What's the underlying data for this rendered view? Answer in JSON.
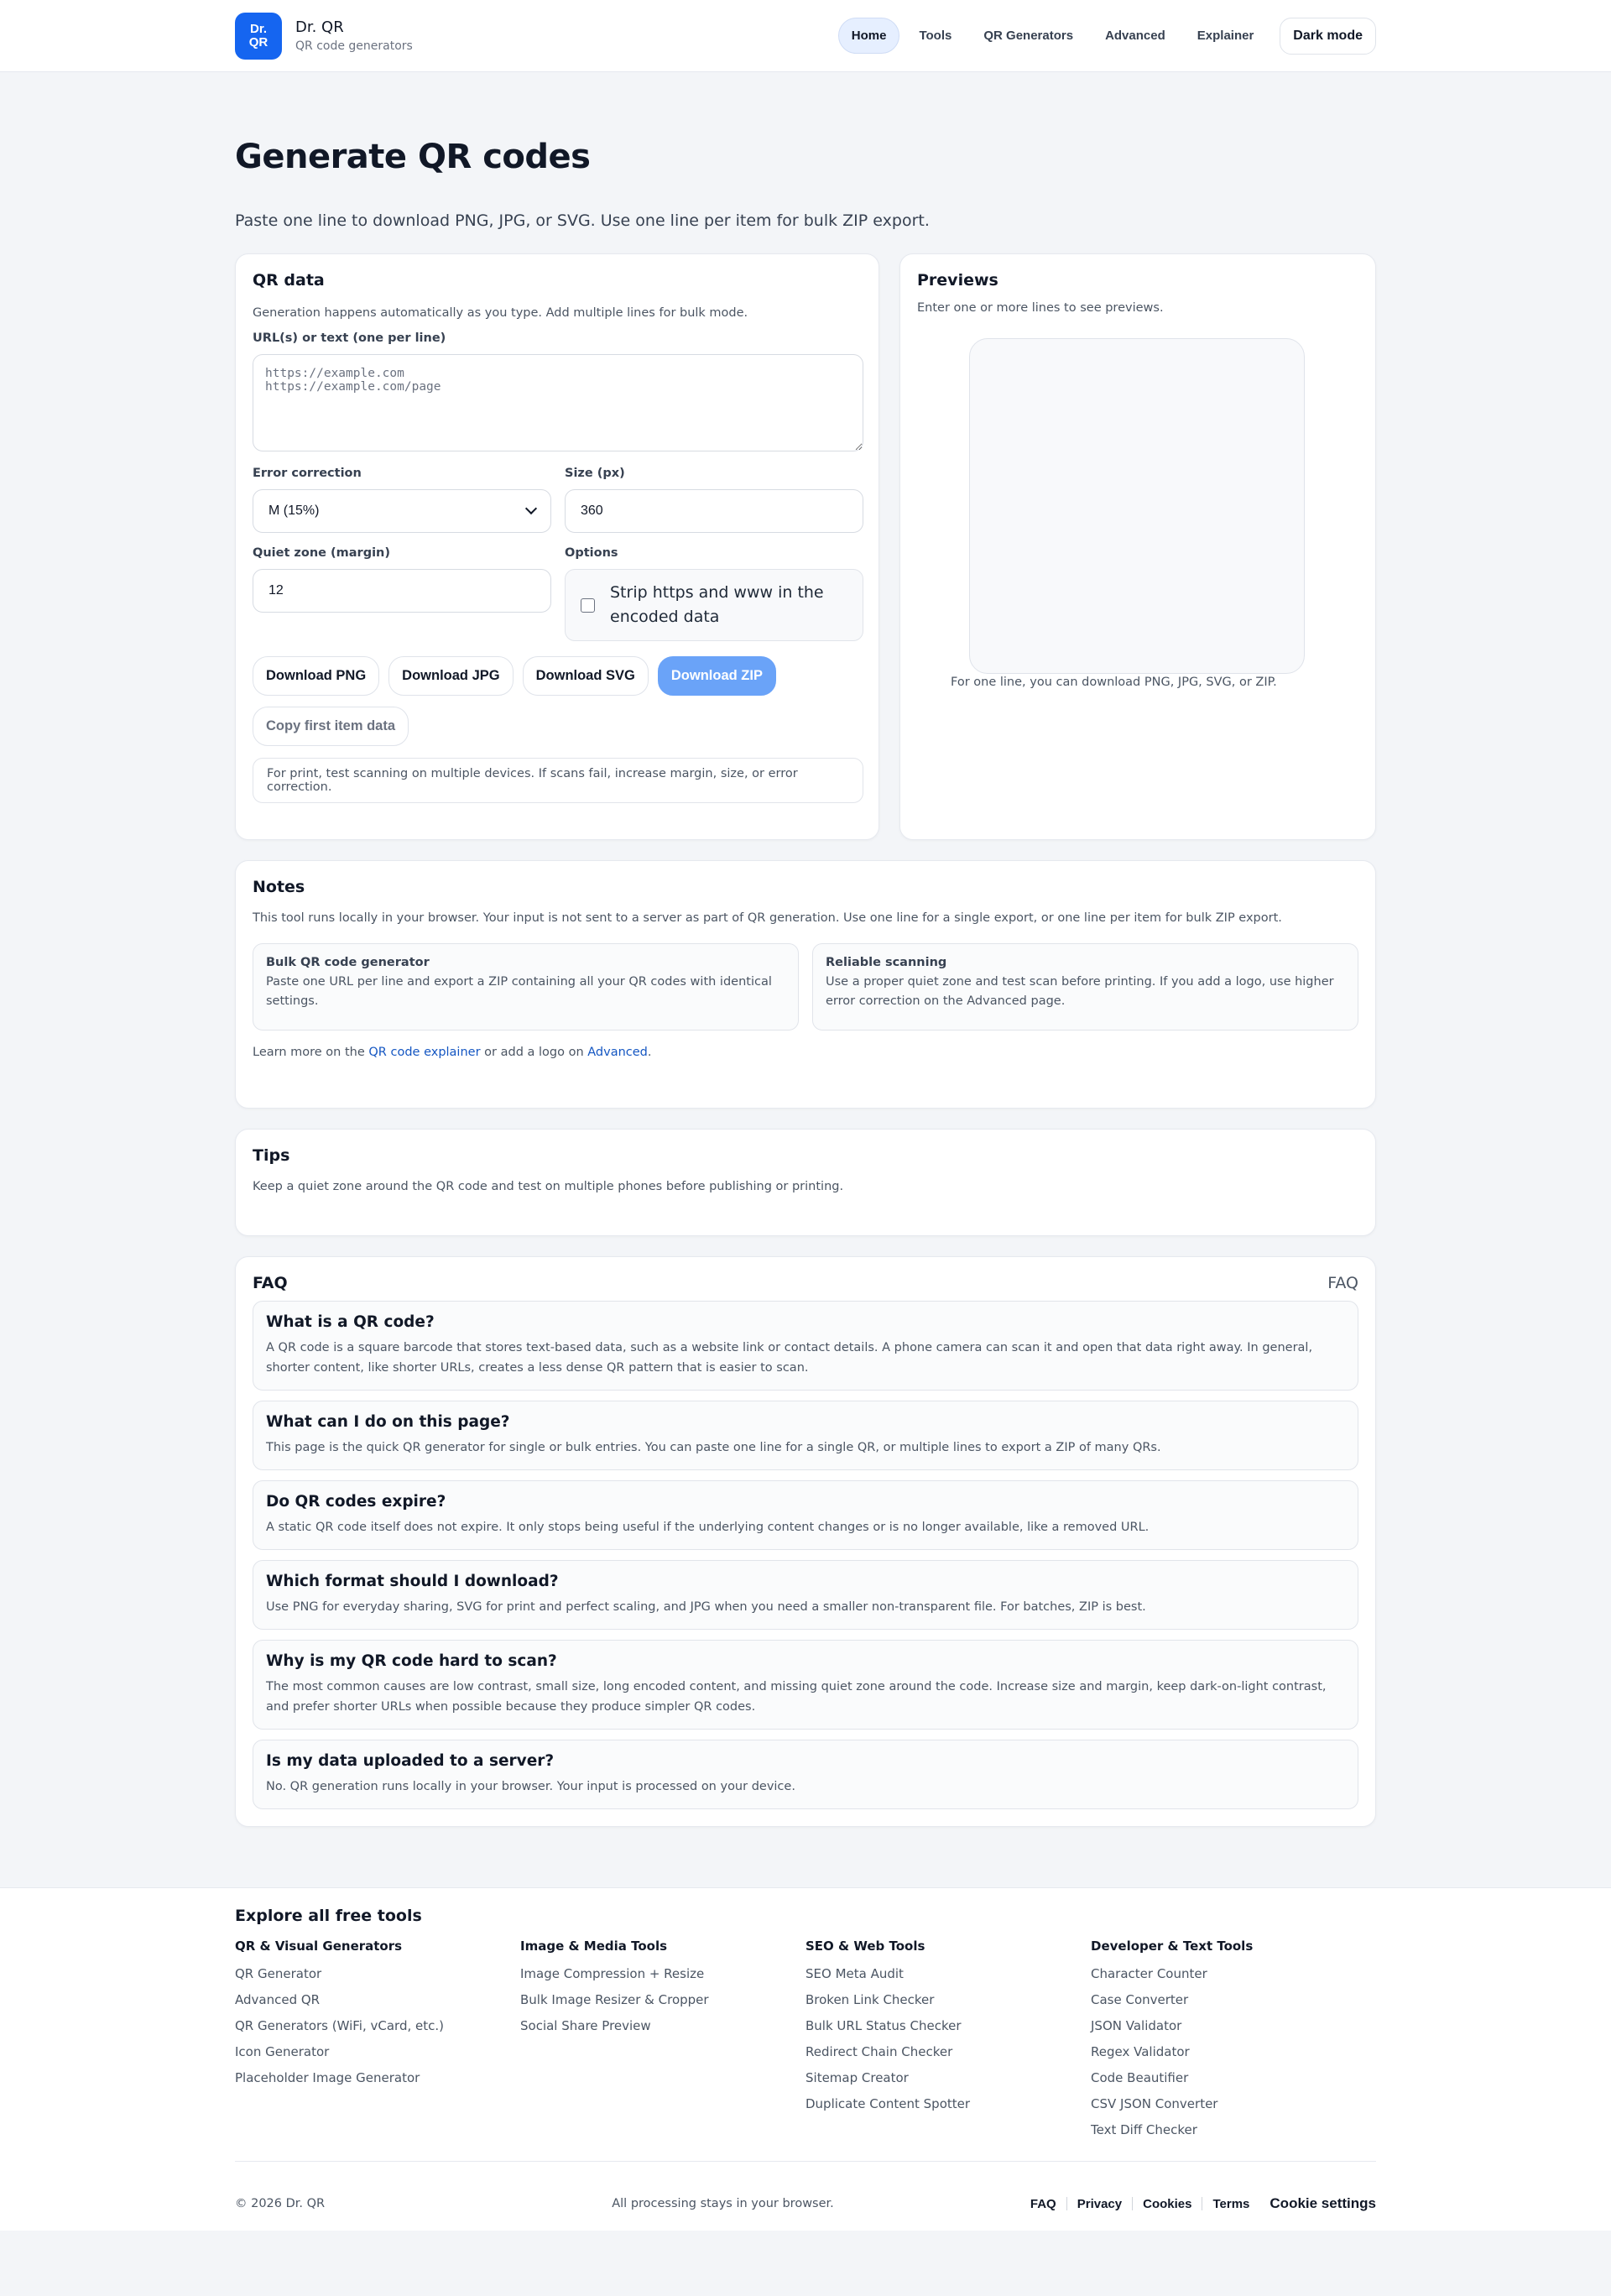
{
  "brand": {
    "logo_line1": "Dr.",
    "logo_line2": "QR",
    "name": "Dr. QR",
    "subtitle": "QR code generators"
  },
  "nav": {
    "items": [
      "Home",
      "Tools",
      "QR Generators",
      "Advanced",
      "Explainer"
    ],
    "active": "Home",
    "dark_mode": "Dark mode"
  },
  "hero": {
    "title": "Generate QR codes",
    "lead": "Paste one line to download PNG, JPG, or SVG. Use one line per item for bulk ZIP export."
  },
  "qr_data": {
    "title": "QR data",
    "desc": "Generation happens automatically as you type. Add multiple lines for bulk mode.",
    "input_label": "URL(s) or text (one per line)",
    "input_placeholder": "https://example.com\nhttps://example.com/page",
    "ec_label": "Error correction",
    "ec_value": "M (15%)",
    "size_label": "Size (px)",
    "size_value": "360",
    "margin_label": "Quiet zone (margin)",
    "margin_value": "12",
    "options_label": "Options",
    "strip_option": "Strip https and www in the encoded data",
    "buttons": {
      "png": "Download PNG",
      "jpg": "Download JPG",
      "svg": "Download SVG",
      "zip": "Download ZIP",
      "copy": "Copy first item data"
    },
    "hint": "For print, test scanning on multiple devices. If scans fail, increase margin, size, or error correction."
  },
  "previews": {
    "title": "Previews",
    "desc": "Enter one or more lines to see previews.",
    "caption": "For one line, you can download PNG, JPG, SVG, or ZIP."
  },
  "notes": {
    "title": "Notes",
    "text": "This tool runs locally in your browser. Your input is not sent to a server as part of QR generation. Use one line for a single export, or one line per item for bulk ZIP export.",
    "boxes": [
      {
        "title": "Bulk QR code generator",
        "desc": "Paste one URL per line and export a ZIP containing all your QR codes with identical settings."
      },
      {
        "title": "Reliable scanning",
        "desc": "Use a proper quiet zone and test scan before printing. If you add a logo, use higher error correction on the Advanced page."
      }
    ],
    "learn_prefix": "Learn more on the ",
    "learn_link1": "QR code explainer",
    "learn_mid": " or add a logo on ",
    "learn_link2": "Advanced",
    "learn_suffix": "."
  },
  "tips": {
    "title": "Tips",
    "text": "Keep a quiet zone around the QR code and test on multiple phones before publishing or printing."
  },
  "faq": {
    "title": "FAQ",
    "side_label": "FAQ",
    "items": [
      {
        "q": "What is a QR code?",
        "a": "A QR code is a square barcode that stores text-based data, such as a website link or contact details. A phone camera can scan it and open that data right away. In general, shorter content, like shorter URLs, creates a less dense QR pattern that is easier to scan."
      },
      {
        "q": "What can I do on this page?",
        "a": "This page is the quick QR generator for single or bulk entries. You can paste one line for a single QR, or multiple lines to export a ZIP of many QRs."
      },
      {
        "q": "Do QR codes expire?",
        "a": "A static QR code itself does not expire. It only stops being useful if the underlying content changes or is no longer available, like a removed URL."
      },
      {
        "q": "Which format should I download?",
        "a": "Use PNG for everyday sharing, SVG for print and perfect scaling, and JPG when you need a smaller non-transparent file. For batches, ZIP is best."
      },
      {
        "q": "Why is my QR code hard to scan?",
        "a": "The most common causes are low contrast, small size, long encoded content, and missing quiet zone around the code. Increase size and margin, keep dark-on-light contrast, and prefer shorter URLs when possible because they produce simpler QR codes."
      },
      {
        "q": "Is my data uploaded to a server?",
        "a": "No. QR generation runs locally in your browser. Your input is processed on your device."
      }
    ]
  },
  "footer": {
    "title": "Explore all free tools",
    "columns": [
      {
        "heading": "QR & Visual Generators",
        "items": [
          "QR Generator",
          "Advanced QR",
          "QR Generators (WiFi, vCard, etc.)",
          "Icon Generator",
          "Placeholder Image Generator"
        ]
      },
      {
        "heading": "Image & Media Tools",
        "items": [
          "Image Compression + Resize",
          "Bulk Image Resizer & Cropper",
          "Social Share Preview"
        ]
      },
      {
        "heading": "SEO & Web Tools",
        "items": [
          "SEO Meta Audit",
          "Broken Link Checker",
          "Bulk URL Status Checker",
          "Redirect Chain Checker",
          "Sitemap Creator",
          "Duplicate Content Spotter"
        ]
      },
      {
        "heading": "Developer & Text Tools",
        "items": [
          "Character Counter",
          "Case Converter",
          "JSON Validator",
          "Regex Validator",
          "Code Beautifier",
          "CSV JSON Converter",
          "Text Diff Checker"
        ]
      }
    ],
    "copyright": "© 2026 Dr. QR",
    "processing": "All processing stays in your browser.",
    "links": [
      "FAQ",
      "Privacy",
      "Cookies",
      "Terms"
    ],
    "cookie_settings": "Cookie settings"
  }
}
